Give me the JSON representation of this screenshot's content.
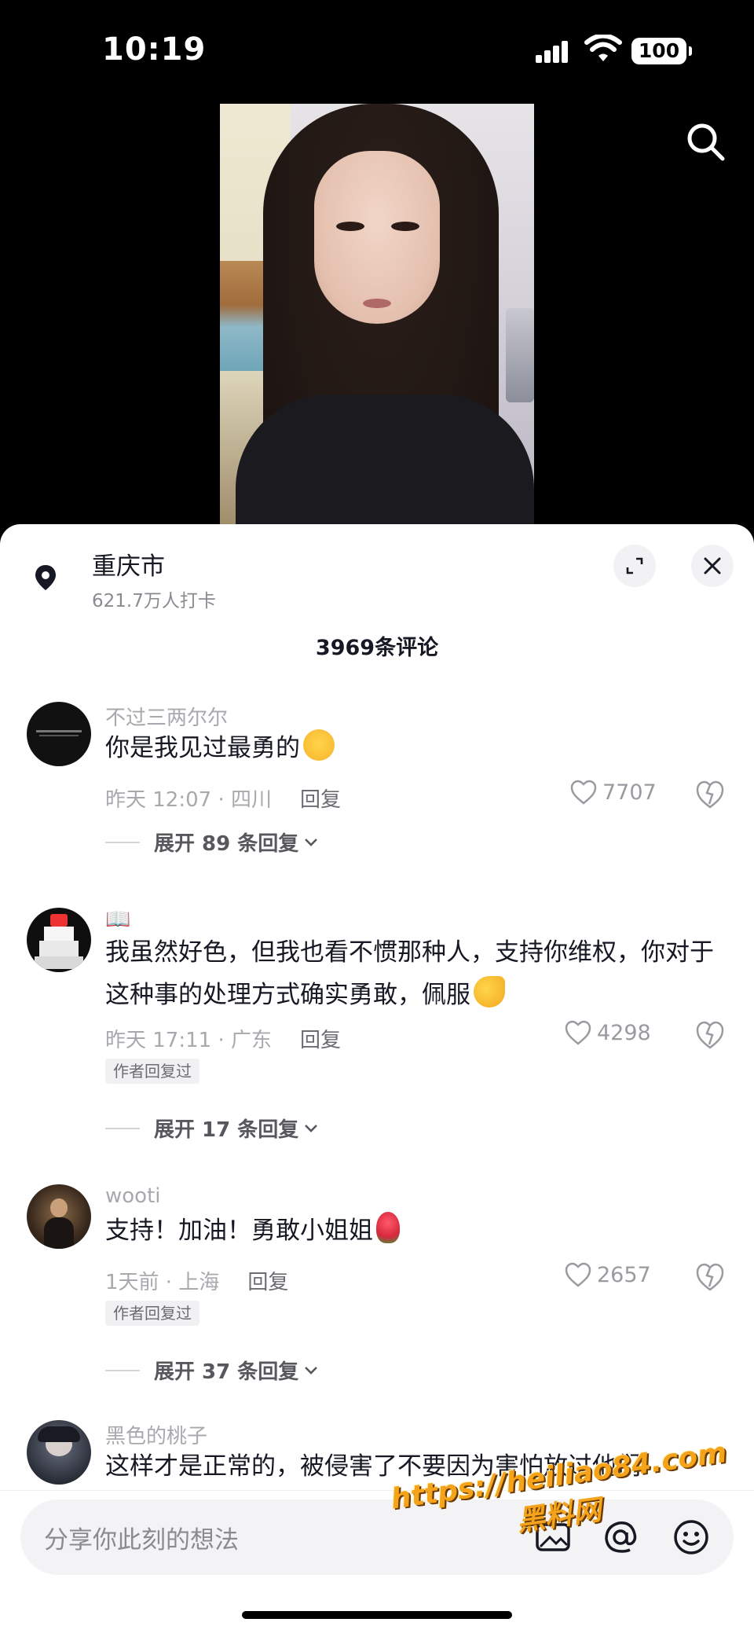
{
  "status_bar": {
    "time": "10:19",
    "battery": "100"
  },
  "location": {
    "name": "重庆市",
    "checkins": "621.7万人打卡"
  },
  "comments_count_title": "3969条评论",
  "comments": [
    {
      "user": "不过三两尔尔",
      "text": "你是我见过最勇的",
      "time_location": "昨天 12:07 · 四川",
      "reply_label": "回复",
      "likes": "7707",
      "expand_label": "展开 89 条回复",
      "author_replied": ""
    },
    {
      "user": "📖",
      "text": "我虽然好色，但我也看不惯那种人，支持你维权，你对于这种事的处理方式确实勇敢，佩服",
      "time_location": "昨天 17:11 · 广东",
      "reply_label": "回复",
      "likes": "4298",
      "expand_label": "展开 17 条回复",
      "author_replied": "作者回复过"
    },
    {
      "user": "wooti",
      "text": "支持！加油！勇敢小姐姐",
      "time_location": "1天前 · 上海",
      "reply_label": "回复",
      "likes": "2657",
      "expand_label": "展开 37 条回复",
      "author_replied": "作者回复过"
    },
    {
      "user": "黑色的桃子",
      "text": "这样才是正常的，被侵害了不要因为害怕放过他们"
    }
  ],
  "input": {
    "placeholder": "分享你此刻的想法"
  },
  "watermark": {
    "url": "https://heiliao84.com",
    "name": "黑料网"
  },
  "colors": {
    "like_gray": "#9a9ba0",
    "watermark": "#f5a31a"
  }
}
